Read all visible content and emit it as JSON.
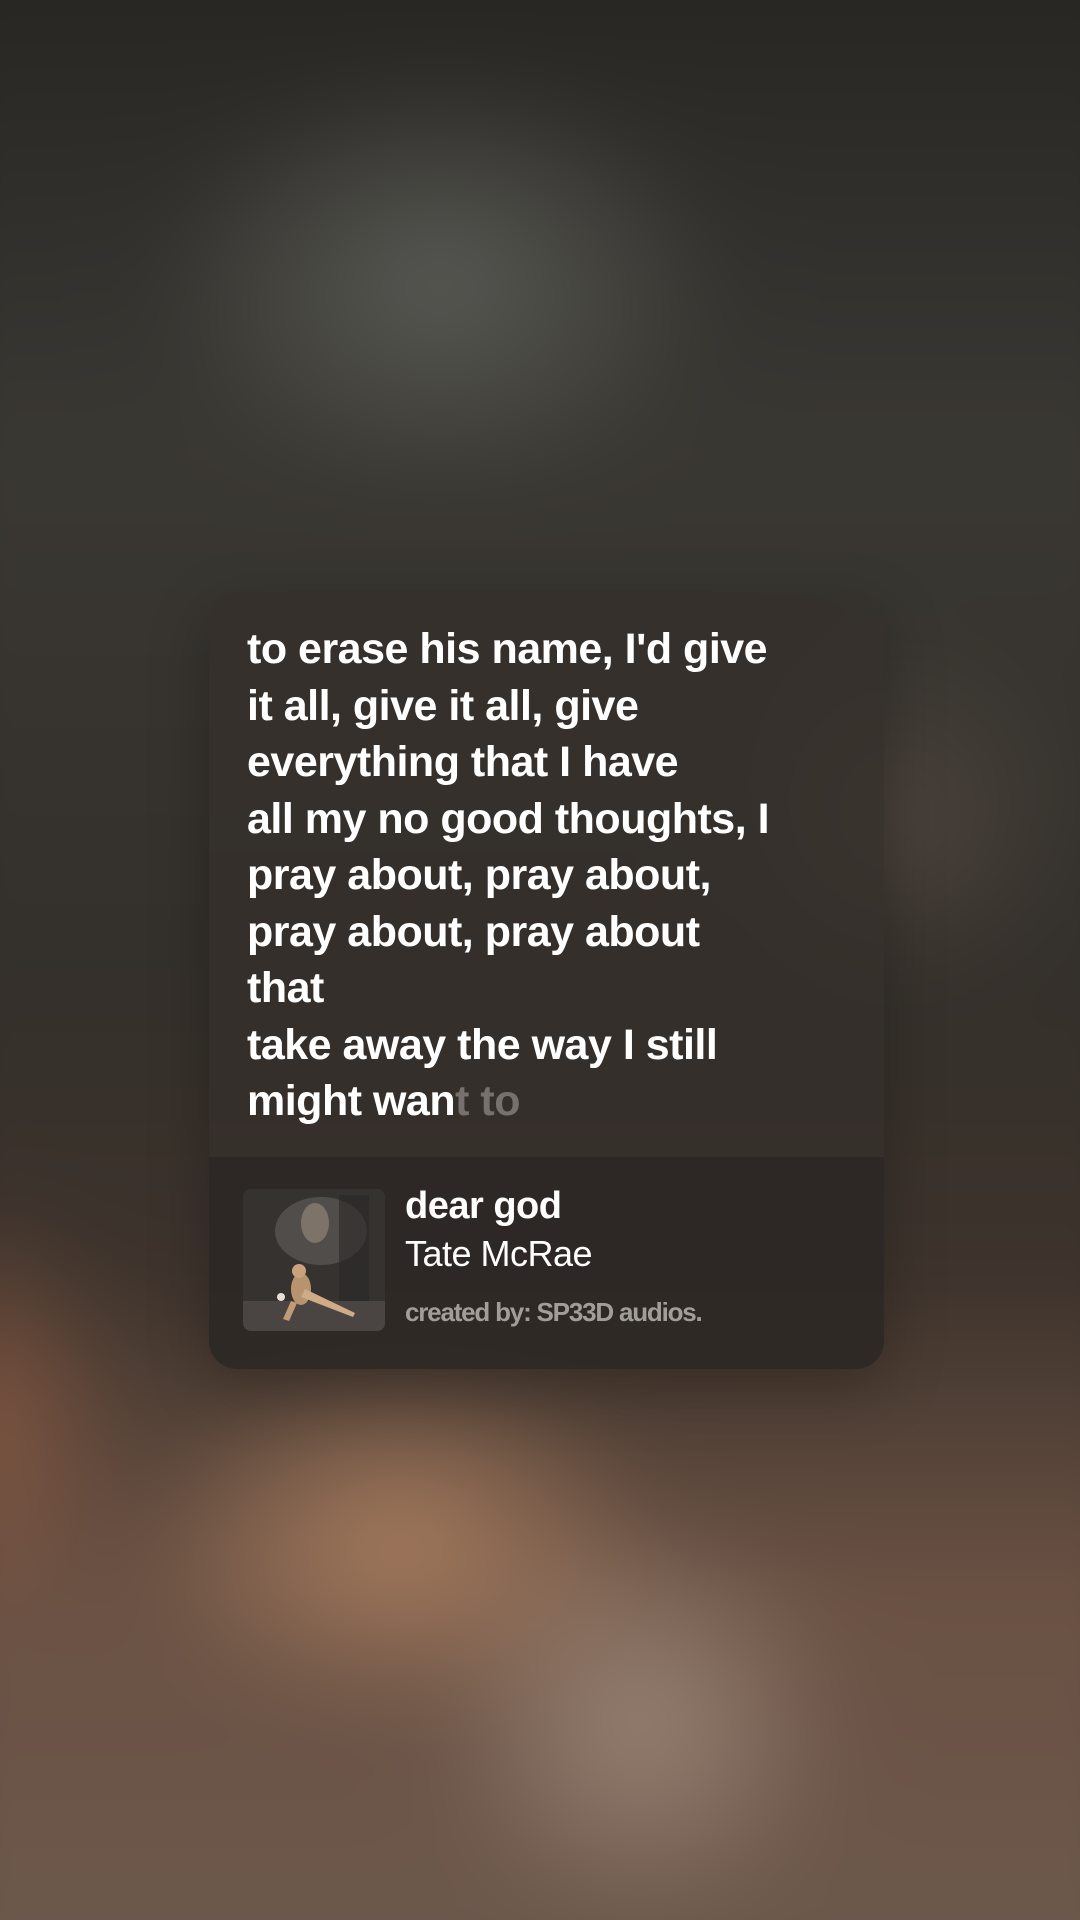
{
  "lyrics_card": {
    "lines": [
      "to erase his name, I'd give",
      "it all, give it all, give",
      "everything that I have",
      "all my no good thoughts, I",
      "pray about, pray about,",
      "pray about, pray about",
      "that",
      "take away the way I still"
    ],
    "last_line_sung": "might wan",
    "last_line_unsung": "t to"
  },
  "track": {
    "title": "dear god",
    "artist": "Tate McRae",
    "credit": "created by: SP33D audios.",
    "cover_icon": "album-cover-image"
  },
  "colors": {
    "lyric_text": "#ffffff",
    "card_bg": "#342f2b",
    "credit_text": "#c8c4be"
  }
}
